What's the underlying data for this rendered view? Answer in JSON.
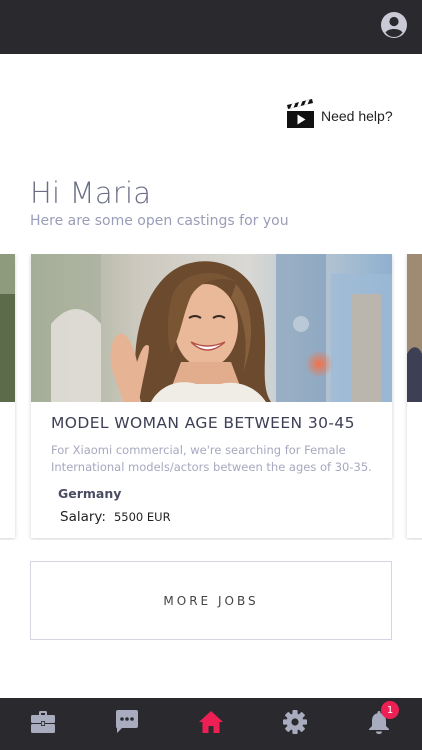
{
  "header": {
    "profile_icon": "account-circle-icon"
  },
  "help": {
    "label": "Need help?",
    "icon": "clapperboard-play-icon"
  },
  "greeting": {
    "title": "Hi Maria",
    "subtitle": "Here are some open castings for you"
  },
  "featured_job": {
    "title": "MODEL WOMAN AGE BETWEEN 30-45",
    "description_line1": "For Xiaomi commercial, we're searching for Female",
    "description_line2": "International models/actors between the ages of 30-35....",
    "location": "Germany",
    "salary_label": "Salary:",
    "salary_value": "5500 EUR"
  },
  "more_jobs": {
    "label": "MORE JOBS"
  },
  "bottom_nav": {
    "items": [
      {
        "id": "jobs",
        "icon": "briefcase-icon",
        "active": false
      },
      {
        "id": "messages",
        "icon": "chat-bubble-icon",
        "active": false
      },
      {
        "id": "home",
        "icon": "home-icon",
        "active": true
      },
      {
        "id": "settings",
        "icon": "gear-icon",
        "active": false
      },
      {
        "id": "notifications",
        "icon": "bell-icon",
        "active": false,
        "badge": "1"
      }
    ]
  },
  "colors": {
    "bar_background": "#2a2a2e",
    "accent": "#ee1f55",
    "icon_inactive": "#a9acbe",
    "greeting_text": "#6a6d84",
    "subtitle_text": "#9a9db7"
  }
}
